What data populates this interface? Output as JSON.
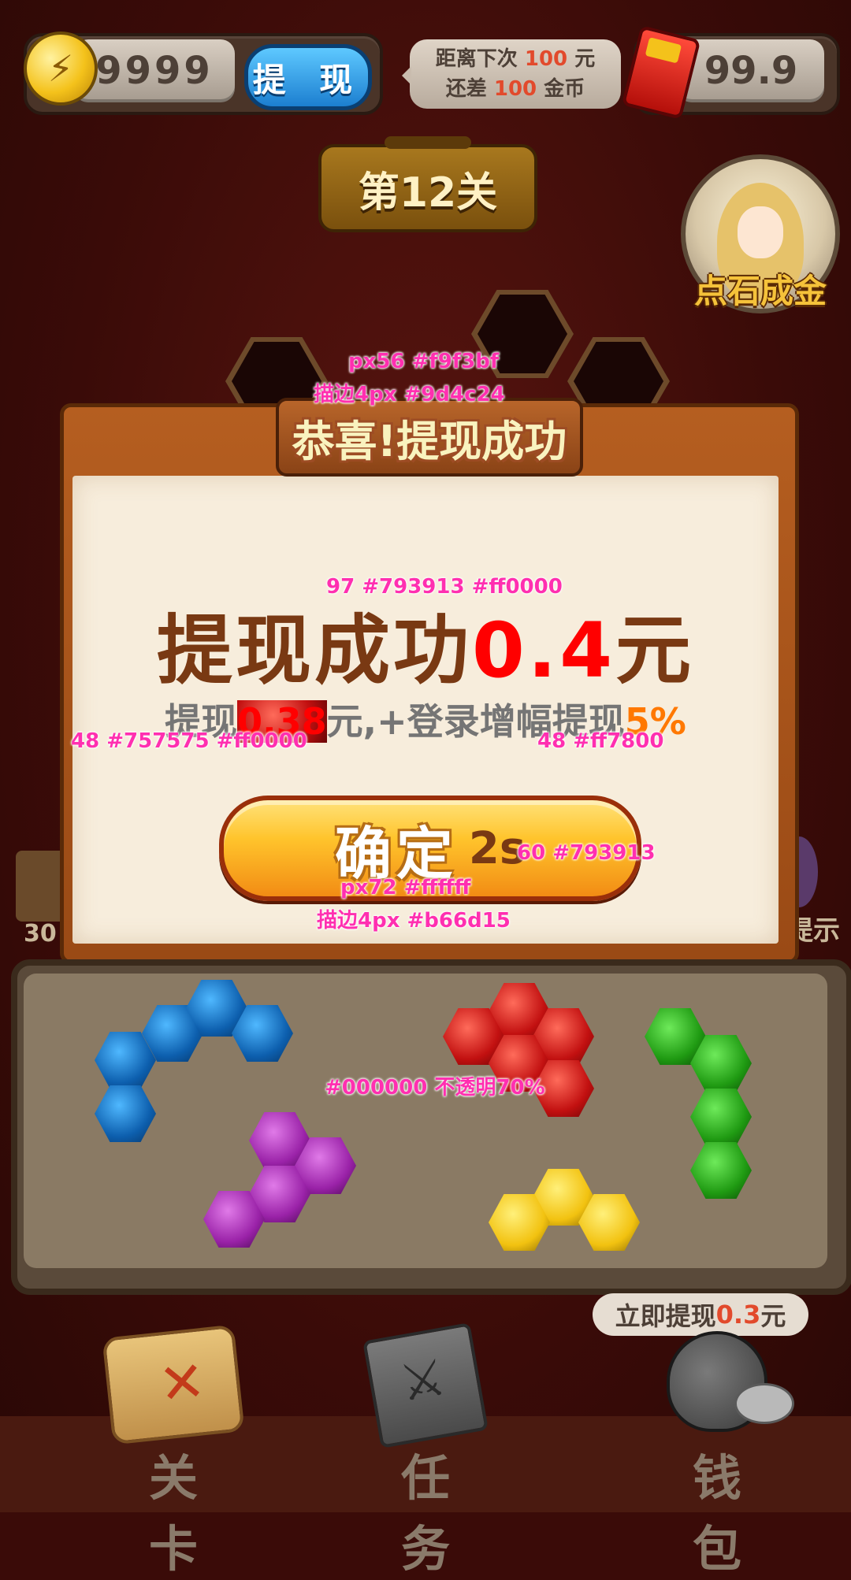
{
  "topbar": {
    "coin_value": "9999",
    "withdraw_label": "提 现",
    "tip_line1_pre": "距离下次",
    "tip_line1_num": "100",
    "tip_line1_post": "元",
    "tip_line2_pre": "还差",
    "tip_line2_num": "100",
    "tip_line2_post": "金币",
    "redpacket_value": "99.9"
  },
  "level": {
    "label": "第12关"
  },
  "avatar": {
    "label": "点石成金"
  },
  "dialog": {
    "title": "恭喜!提现成功",
    "main_text": "提现成功",
    "main_amount": "0.4",
    "main_unit": "元",
    "sub_pre": "提现",
    "sub_amount": "0.38",
    "sub_mid": "元,+登录增幅提现",
    "sub_percent": "5%",
    "confirm_label": "确定",
    "confirm_timer": "2s"
  },
  "annotations": {
    "title_font": "px56 #f9f3bf",
    "title_stroke": "描边4px #9d4c24",
    "main_spec": "97 #793913 #ff0000",
    "sub_spec_left": "48 #757575 #ff0000",
    "sub_spec_right": "48 #ff7800",
    "timer_spec": "60 #793913",
    "btn_font": "px72 #ffffff",
    "btn_stroke": "描边4px #b66d15",
    "overlay_spec": "#000000 不透明70%"
  },
  "side": {
    "left_label": "30",
    "right_label": "提示"
  },
  "tooltip": {
    "pre": "立即提现",
    "amount": "0.3",
    "post": "元"
  },
  "nav": [
    {
      "label": "关卡",
      "icon": "map-scroll-icon"
    },
    {
      "label": "任务",
      "icon": "quest-book-icon"
    },
    {
      "label": "钱包",
      "icon": "money-bag-icon"
    }
  ],
  "colors": {
    "title_fill": "#f9f3bf",
    "title_stroke": "#9d4c24",
    "main_brown": "#793913",
    "accent_red": "#ff0000",
    "sub_gray": "#757575",
    "accent_orange": "#ff7800",
    "btn_stroke": "#b66d15"
  }
}
